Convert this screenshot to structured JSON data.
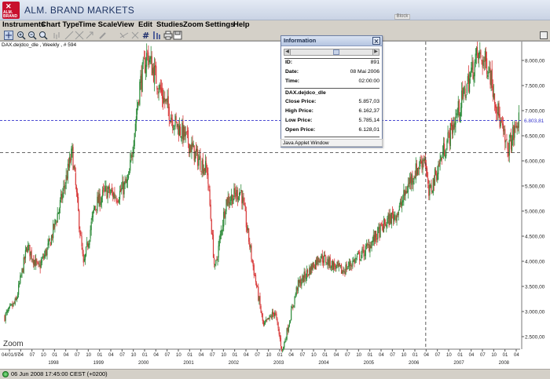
{
  "window": {
    "title": "ALM. BRAND MARKETS",
    "logo_mark": "✕",
    "logo_text": "ALM. BRAND",
    "block_chip": "Block"
  },
  "menu": {
    "items": [
      "Instruments",
      "Chart Type",
      "Time Scale",
      "View",
      "Edit",
      "Studies",
      "Zoom",
      "Settings",
      "Help"
    ]
  },
  "toolbar": {
    "icons": [
      "crosshair-icon",
      "zoom-in-icon",
      "zoom-out-icon",
      "zoom-reset-icon",
      "bar-chart-icon",
      "trend-line-icon",
      "fibonacci-icon",
      "arrow-icon",
      "pencil-icon",
      "line-style-icon",
      "delete-icon",
      "grid-icon",
      "indicator-icon",
      "print-icon",
      "save-icon"
    ]
  },
  "chart": {
    "caption": "DAX.de|dco_dle , Weekly , # 594",
    "zoom_label": "Zoom",
    "crosshair_value": "6.803,81",
    "colors": {
      "up": "#2e8b3a",
      "down": "#d83b3b",
      "crosshair": "#3333cc",
      "cursor": "#333333"
    }
  },
  "chart_data": {
    "type": "candlestick",
    "title": "DAX.de|dco_dle , Weekly , # 594",
    "y_ticks": [
      "8.000,00",
      "7.500,00",
      "7.000,00",
      "6.500,00",
      "6.000,00",
      "5.500,00",
      "5.000,00",
      "4.500,00",
      "4.000,00",
      "3.500,00",
      "3.000,00",
      "2.500,00"
    ],
    "ylim": [
      2300,
      8150
    ],
    "x_tick_labels": [
      "04/01/97",
      "04",
      "07",
      "10",
      "01",
      "04",
      "07",
      "10",
      "01",
      "04",
      "07",
      "10",
      "01",
      "04",
      "07",
      "10",
      "01",
      "04",
      "07",
      "10",
      "01",
      "04",
      "07",
      "10",
      "01",
      "04",
      "07",
      "10",
      "01",
      "04",
      "07",
      "10",
      "01",
      "04",
      "07",
      "10",
      "01",
      "04",
      "07",
      "10",
      "01",
      "04",
      "07",
      "10",
      "01",
      "04"
    ],
    "year_labels": [
      "1998",
      "1999",
      "2000",
      "2001",
      "2002",
      "2003",
      "2004",
      "2005",
      "2006",
      "2007",
      "2008"
    ],
    "series_close": [
      {
        "x": "1997-01",
        "y": 2900
      },
      {
        "x": "1997-04",
        "y": 3200
      },
      {
        "x": "1997-07",
        "y": 4300
      },
      {
        "x": "1997-10",
        "y": 3850
      },
      {
        "x": "1998-01",
        "y": 4350
      },
      {
        "x": "1998-04",
        "y": 5200
      },
      {
        "x": "1998-07",
        "y": 6171
      },
      {
        "x": "1998-10",
        "y": 3900
      },
      {
        "x": "1999-01",
        "y": 5100
      },
      {
        "x": "1999-04",
        "y": 5400
      },
      {
        "x": "1999-07",
        "y": 5300
      },
      {
        "x": "1999-10",
        "y": 5600
      },
      {
        "x": "2000-01",
        "y": 7500
      },
      {
        "x": "2000-03",
        "y": 8136
      },
      {
        "x": "2000-07",
        "y": 7300
      },
      {
        "x": "2000-10",
        "y": 6800
      },
      {
        "x": "2001-01",
        "y": 6500
      },
      {
        "x": "2001-04",
        "y": 6100
      },
      {
        "x": "2001-07",
        "y": 5800
      },
      {
        "x": "2001-09",
        "y": 3800
      },
      {
        "x": "2001-12",
        "y": 5200
      },
      {
        "x": "2002-04",
        "y": 5400
      },
      {
        "x": "2002-07",
        "y": 4000
      },
      {
        "x": "2002-10",
        "y": 2700
      },
      {
        "x": "2003-01",
        "y": 3000
      },
      {
        "x": "2003-03",
        "y": 2200
      },
      {
        "x": "2003-07",
        "y": 3500
      },
      {
        "x": "2003-10",
        "y": 3800
      },
      {
        "x": "2004-01",
        "y": 4100
      },
      {
        "x": "2004-07",
        "y": 3800
      },
      {
        "x": "2005-01",
        "y": 4200
      },
      {
        "x": "2005-07",
        "y": 4800
      },
      {
        "x": "2005-10",
        "y": 5000
      },
      {
        "x": "2006-01",
        "y": 5600
      },
      {
        "x": "2006-05",
        "y": 6100
      },
      {
        "x": "2006-06",
        "y": 5300
      },
      {
        "x": "2006-10",
        "y": 6200
      },
      {
        "x": "2007-01",
        "y": 6800
      },
      {
        "x": "2007-07",
        "y": 8100
      },
      {
        "x": "2007-10",
        "y": 7900
      },
      {
        "x": "2008-01",
        "y": 6800
      },
      {
        "x": "2008-03",
        "y": 6200
      },
      {
        "x": "2008-06",
        "y": 6804
      }
    ]
  },
  "info_window": {
    "title": "Information",
    "rows_top": [
      {
        "key": "ID:",
        "value": "891"
      },
      {
        "key": "Date:",
        "value": "08 Mai 2006"
      },
      {
        "key": "Time:",
        "value": "02:00:00"
      }
    ],
    "symbol": "DAX.de|dco_dle",
    "rows_bottom": [
      {
        "key": "Close Price:",
        "value": "5.857,03"
      },
      {
        "key": "High Price:",
        "value": "6.162,37"
      },
      {
        "key": "Low Price:",
        "value": "5.785,14"
      },
      {
        "key": "Open Price:",
        "value": "6.128,01"
      }
    ],
    "footer": "Java Applet Window"
  },
  "status": {
    "text": "06 Jun 2008 17:45:00  CEST (+0200)"
  }
}
